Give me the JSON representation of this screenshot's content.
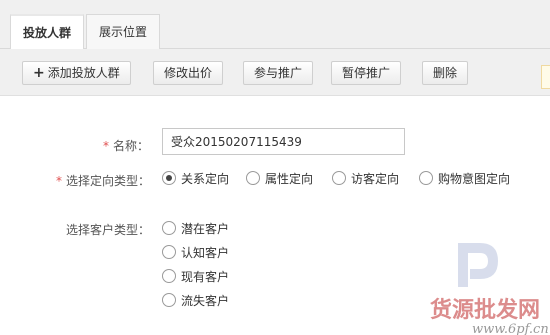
{
  "tabs": [
    {
      "label": "投放人群",
      "active": true
    },
    {
      "label": "展示位置",
      "active": false
    }
  ],
  "toolbar": {
    "add_label": "添加投放人群",
    "modify_bid_label": "修改出价",
    "join_promo_label": "参与推广",
    "pause_promo_label": "暂停推广",
    "delete_label": "删除"
  },
  "form": {
    "name_label": "名称：",
    "name_value": "受众20150207115439",
    "target_type_label": "选择定向类型：",
    "target_options": [
      "关系定向",
      "属性定向",
      "访客定向",
      "购物意图定向"
    ],
    "target_selected": 0,
    "customer_type_label": "选择客户类型：",
    "customer_options": [
      "潜在客户",
      "认知客户",
      "现有客户",
      "流失客户"
    ]
  },
  "watermark": {
    "text": "货源批发网",
    "url": "www.6pf.cn"
  },
  "colors": {
    "required": "#e05050",
    "watermark": "#c03030"
  }
}
